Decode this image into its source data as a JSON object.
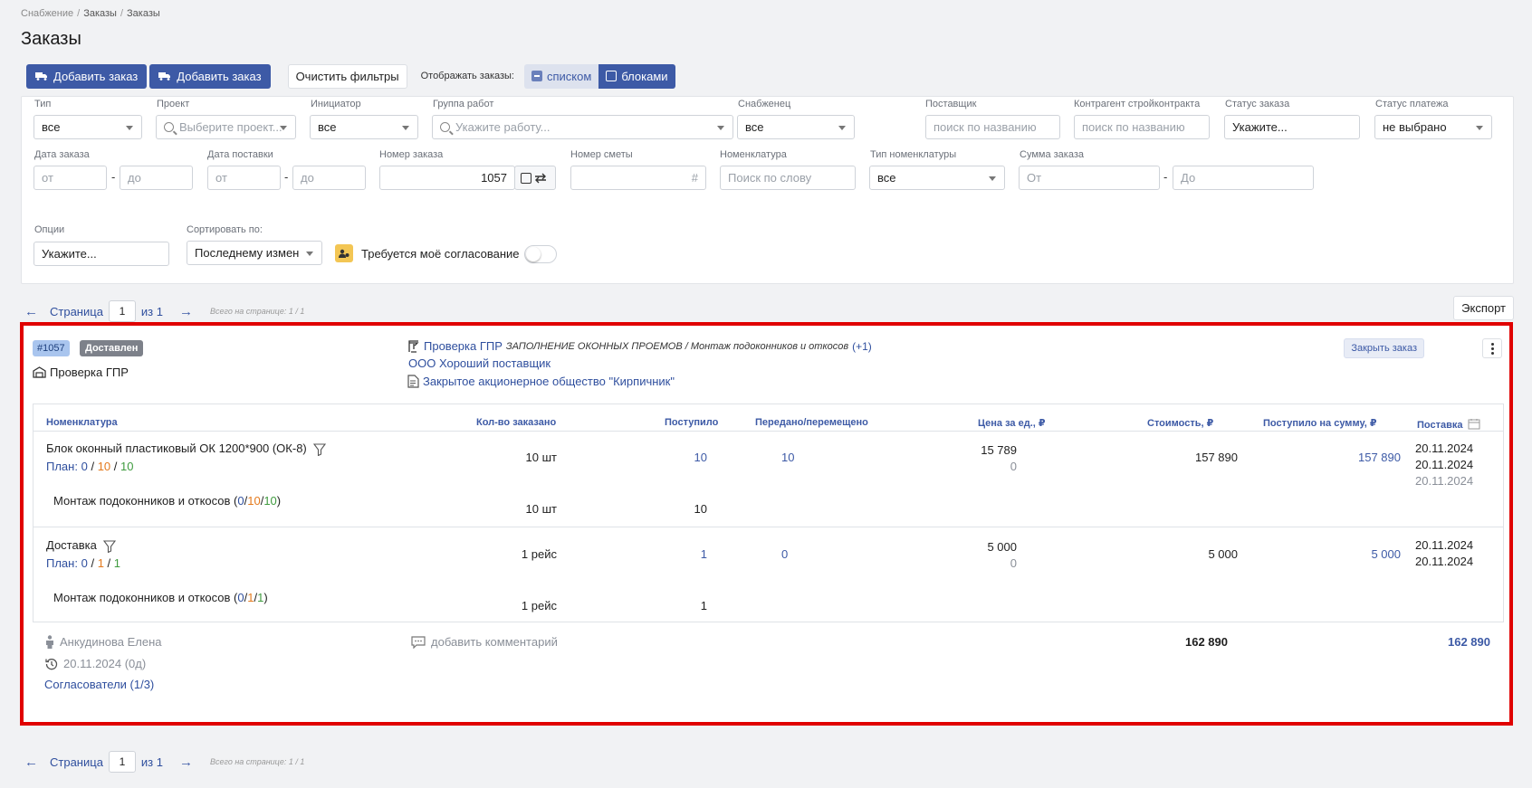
{
  "breadcrumb": {
    "items": [
      "Снабжение",
      "Заказы",
      "Заказы"
    ]
  },
  "page_title": "Заказы",
  "toolbar": {
    "add_order_1": "Добавить заказ",
    "add_order_2": "Добавить заказ",
    "clear_filters": "Очистить фильтры",
    "display_label": "Отображать заказы:",
    "view_list": "списком",
    "view_blocks": "блоками"
  },
  "filters": {
    "type": {
      "label": "Тип",
      "value": "все"
    },
    "project": {
      "label": "Проект",
      "placeholder": "Выберите проект..."
    },
    "initiator": {
      "label": "Инициатор",
      "value": "все"
    },
    "work_group": {
      "label": "Группа работ",
      "placeholder": "Укажите работу..."
    },
    "supplier_manager": {
      "label": "Снабженец",
      "value": "все"
    },
    "supplier": {
      "label": "Поставщик",
      "placeholder": "поиск по названию"
    },
    "contractor": {
      "label": "Контрагент стройконтракта",
      "placeholder": "поиск по названию"
    },
    "order_status": {
      "label": "Статус заказа",
      "value": "Укажите..."
    },
    "payment_status": {
      "label": "Статус платежа",
      "value": "не выбрано"
    },
    "order_date": {
      "label": "Дата заказа",
      "from": "от",
      "to": "до"
    },
    "delivery_date": {
      "label": "Дата поставки",
      "from": "от",
      "to": "до"
    },
    "order_number": {
      "label": "Номер заказа",
      "value": "1057"
    },
    "estimate_number": {
      "label": "Номер сметы",
      "suffix": "#"
    },
    "nomenclature": {
      "label": "Номенклатура",
      "placeholder": "Поиск по слову"
    },
    "nomenclature_type": {
      "label": "Тип номенклатуры",
      "value": "все"
    },
    "order_sum": {
      "label": "Сумма заказа",
      "from": "От",
      "to": "До"
    },
    "options": {
      "label": "Опции",
      "value": "Укажите..."
    },
    "sort": {
      "label": "Сортировать по:",
      "value": "Последнему измен"
    },
    "my_approval": {
      "label": "Требуется моё согласование",
      "enabled": false
    },
    "dash": "-"
  },
  "pager": {
    "prev": "←",
    "page_label": "Страница",
    "page": "1",
    "of": "из 1",
    "next": "→",
    "note": "Всего на странице: 1 / 1"
  },
  "export": "Экспорт",
  "order": {
    "id": "#1057",
    "status": "Доставлен",
    "project": "Проверка ГПР",
    "project_link": "Проверка ГПР",
    "work_path": "ЗАПОЛНЕНИЕ ОКОННЫХ ПРОЕМОВ / Монтаж подоконников и откосов",
    "work_extra": "(+1)",
    "supplier": "ООО Хороший поставщик",
    "contractor": "Закрытое акционерное общество \"Кирпичник\"",
    "close_button": "Закрыть заказ",
    "columns": [
      "Номенклатура",
      "Кол-во заказано",
      "Поступило",
      "Передано/перемещено",
      "Цена за ед., ₽",
      "Стоимость, ₽",
      "Поступило на сумму, ₽",
      "Поставка"
    ],
    "items": [
      {
        "name": "Блок оконный пластиковый ОК 1200*900 (ОК-8)",
        "plan_label": "План:",
        "plan_a": "0",
        "plan_b": "10",
        "plan_c": "10",
        "slash": "/",
        "qty": "10 шт",
        "received": "10",
        "transferred": "10",
        "price": "15 789",
        "price_sub": "0",
        "cost": "157 890",
        "received_sum": "157 890",
        "dates": [
          "20.11.2024",
          "20.11.2024",
          "20.11.2024"
        ],
        "sub_name": "Монтаж подоконников и откосов",
        "sub_a": "0",
        "sub_b": "10",
        "sub_c": "10",
        "sub_qty": "10 шт",
        "sub_received": "10"
      },
      {
        "name": "Доставка",
        "plan_label": "План:",
        "plan_a": "0",
        "plan_b": "1",
        "plan_c": "1",
        "slash": "/",
        "qty": "1 рейс",
        "received": "1",
        "transferred": "0",
        "price": "5 000",
        "price_sub": "0",
        "cost": "5 000",
        "received_sum": "5 000",
        "dates": [
          "20.11.2024",
          "20.11.2024"
        ],
        "sub_name": "Монтаж подоконников и откосов",
        "sub_a": "0",
        "sub_b": "1",
        "sub_c": "1",
        "sub_qty": "1 рейс",
        "sub_received": "1"
      }
    ],
    "author": "Анкудинова Елена",
    "created": "20.11.2024 (0д)",
    "approvers": "Согласователи (1/3)",
    "add_comment": "добавить комментарий",
    "total_cost": "162 890",
    "total_received": "162 890"
  },
  "colors": {
    "primary": "#3d5aa6",
    "highlight_border": "#e00000",
    "orange": "#e47a1d",
    "green": "#3f9b3f"
  }
}
